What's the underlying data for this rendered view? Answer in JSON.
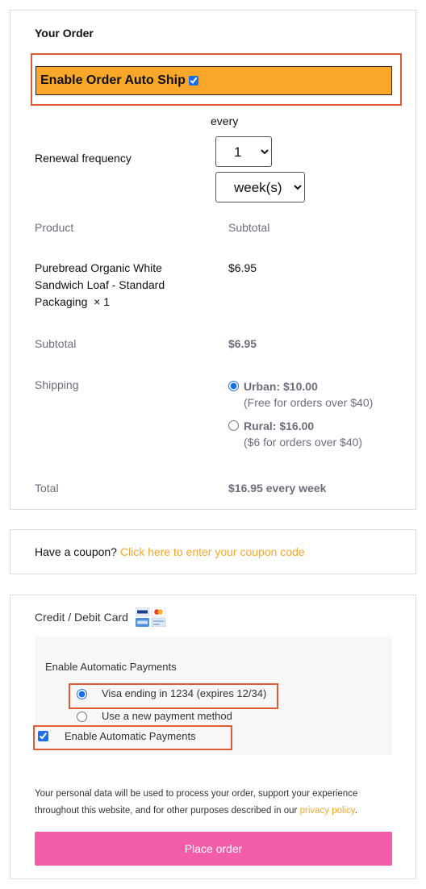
{
  "order": {
    "title": "Your Order",
    "autoship_label": "Enable Order Auto Ship",
    "autoship_checked": true,
    "every_label": "every",
    "renewal_label": "Renewal frequency",
    "frequency_value": "1",
    "frequency_unit": "week(s)",
    "headers": {
      "product": "Product",
      "subtotal": "Subtotal"
    },
    "item": {
      "name_line1": "Purebread Organic White",
      "name_line2": "Sandwich Loaf - Standard",
      "name_line3": "Packaging",
      "quantity": "× 1",
      "price": "$6.95"
    },
    "subtotal_label": "Subtotal",
    "subtotal_value": "$6.95",
    "shipping_label": "Shipping",
    "shipping_options": [
      {
        "label": "Urban: $10.00",
        "note": "(Free for orders over $40)",
        "selected": true
      },
      {
        "label": "Rural: $16.00",
        "note": "($6 for orders over $40)",
        "selected": false
      }
    ],
    "total_label": "Total",
    "total_value": "$16.95 every week"
  },
  "coupon": {
    "prompt": "Have a coupon?",
    "link": "Click here to enter your coupon code"
  },
  "payment": {
    "method_label": "Credit / Debit Card",
    "card_icons": [
      "visa-icon",
      "mastercard-icon",
      "amex-icon"
    ],
    "auto_payments_title": "Enable Automatic Payments",
    "saved_card": "Visa ending in 1234 (expires 12/34)",
    "new_method": "Use a new payment method",
    "auto_payments_checkbox": "Enable Automatic Payments",
    "privacy_text": "Your personal data will be used to process your order, support your experience throughout this website, and for other purposes described in our",
    "privacy_link": "privacy policy",
    "place_order": "Place order"
  },
  "colors": {
    "autoship_bg": "#f9a72a",
    "highlight_border": "#e05a33",
    "link": "#f9a72a",
    "place_order_bg": "#f25ca8"
  }
}
